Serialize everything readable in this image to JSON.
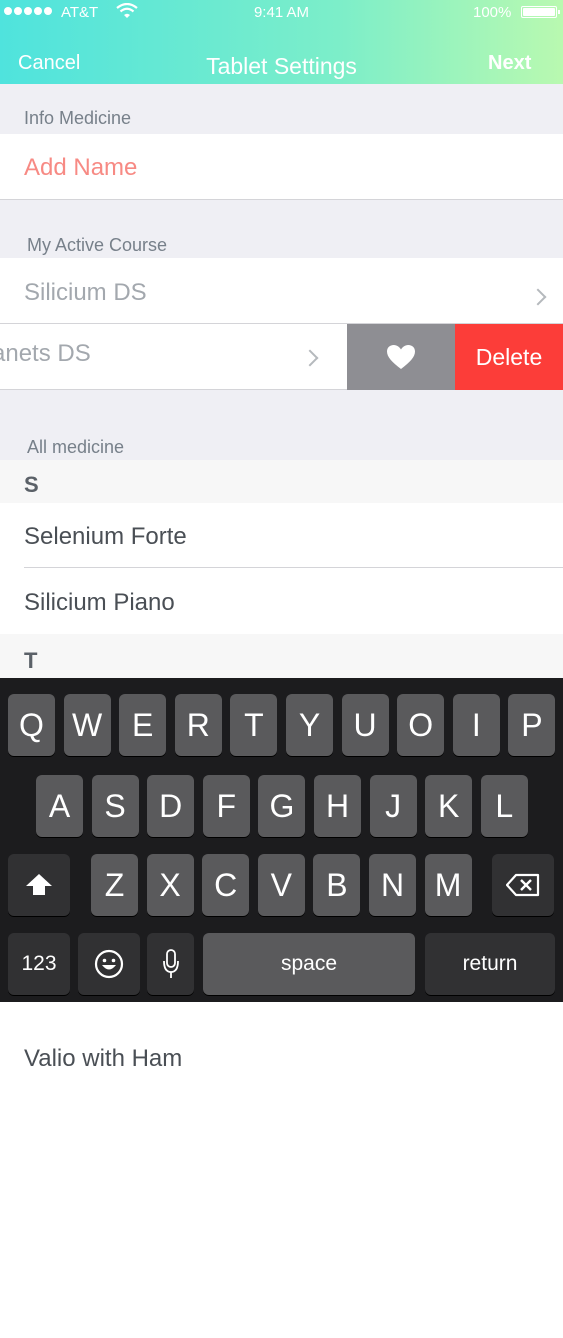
{
  "status_bar": {
    "carrier": "AT&T",
    "time": "9:41 AM",
    "battery": "100%",
    "wifi_icon": "wifi-icon"
  },
  "nav": {
    "cancel": "Cancel",
    "title": "Tablet Settings",
    "next": "Next"
  },
  "info_section": {
    "label": "Info Medicine",
    "name_placeholder": "Add Name",
    "accent_color": "#f78a84"
  },
  "active_course": {
    "label": "My Active Course",
    "items": [
      {
        "name": "Silicium DS"
      },
      {
        "name": "Planets DS",
        "visible_text": "anets DS"
      }
    ],
    "actions": {
      "favorite_icon": "heart-icon",
      "delete": "Delete",
      "delete_color": "#fc3d39"
    }
  },
  "all_medicine": {
    "label": "All medicine",
    "groups": [
      {
        "letter": "S",
        "items": [
          "Selenium Forte",
          "Silicium Piano"
        ]
      },
      {
        "letter": "T",
        "items": [
          "Valio with Ham"
        ]
      }
    ]
  },
  "keyboard": {
    "row1": [
      "Q",
      "W",
      "E",
      "R",
      "T",
      "Y",
      "U",
      "O",
      "I",
      "P"
    ],
    "row2": [
      "A",
      "S",
      "D",
      "F",
      "G",
      "H",
      "J",
      "K",
      "L"
    ],
    "row3": [
      "Z",
      "X",
      "C",
      "V",
      "B",
      "N",
      "M"
    ],
    "shift_icon": "shift-icon",
    "backspace_icon": "backspace-icon",
    "numbers": "123",
    "emoji_icon": "emoji-icon",
    "mic_icon": "microphone-icon",
    "space": "space",
    "return": "return"
  }
}
